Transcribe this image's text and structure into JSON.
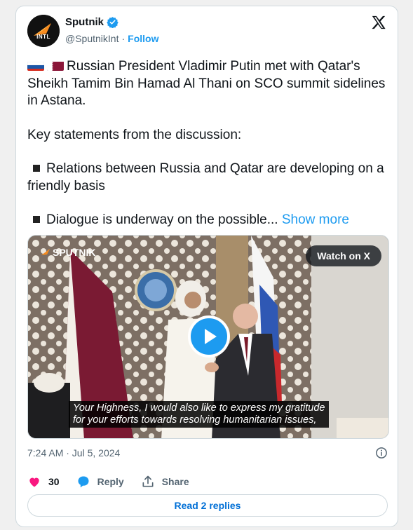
{
  "account": {
    "display_name": "Sputnik",
    "avatar_text": "INTL",
    "handle": "@SputnikInt",
    "separator": "·",
    "follow_label": "Follow"
  },
  "tweet": {
    "line1": "Russian President Vladimir Putin met with Qatar's Sheikh Tamim Bin Hamad Al Thani on SCO summit sidelines in Astana.",
    "line2": "Key statements from the discussion:",
    "bullet1": "Relations between Russia and Qatar are developing on a friendly basis",
    "bullet2": "Dialogue is underway on the possible...",
    "show_more": "Show more",
    "flags": [
      "russia-flag",
      "qatar-flag"
    ]
  },
  "media": {
    "watch_label": "Watch on X",
    "watermark": "SPUTNIK",
    "subtitle_line1": "Your Highness, I would also like to express my gratitude",
    "subtitle_line2": "for your efforts towards resolving humanitarian issues,"
  },
  "meta": {
    "timestamp": "7:24 AM · Jul 5, 2024"
  },
  "actions": {
    "like_count": "30",
    "reply_label": "Reply",
    "share_label": "Share",
    "read_replies_label": "Read 2 replies"
  },
  "colors": {
    "accent": "#1d9bf0",
    "like": "#f91880",
    "text": "#0f1419",
    "secondary": "#536471"
  }
}
